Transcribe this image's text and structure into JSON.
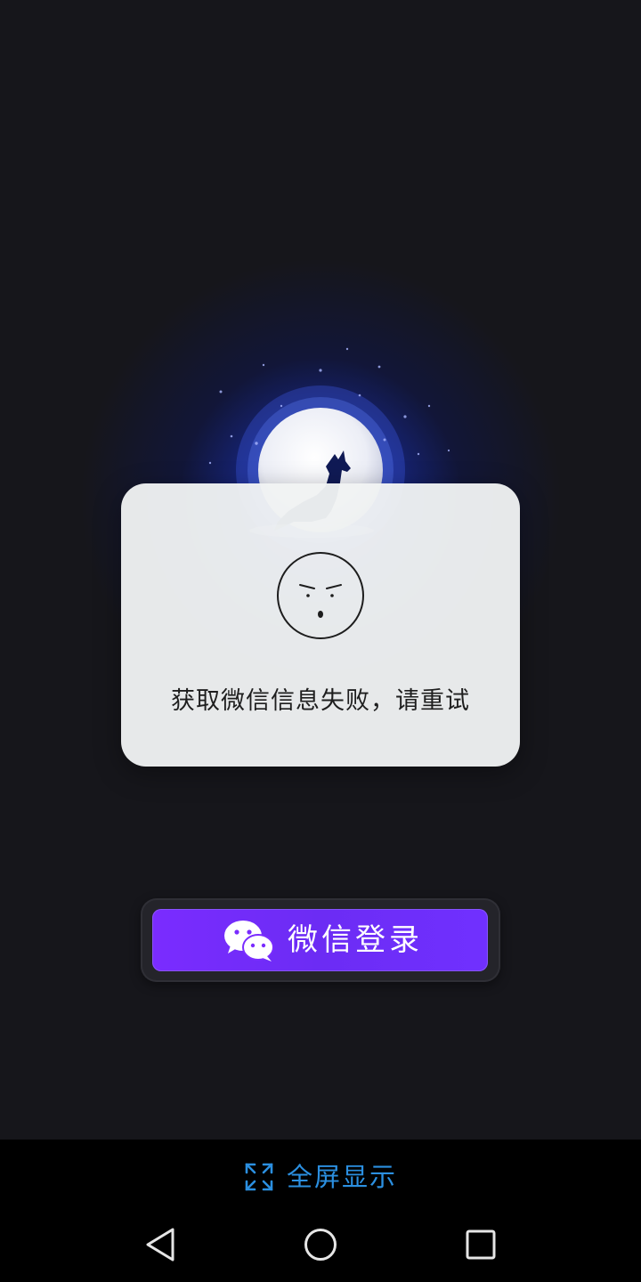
{
  "dialog": {
    "message": "获取微信信息失败，请重试",
    "face_icon": "angry-face-icon"
  },
  "login": {
    "label": "微信登录",
    "icon": "wechat-icon",
    "color": "#7a2cff"
  },
  "bottom_bar": {
    "fullscreen_label": "全屏显示",
    "fullscreen_icon": "expand-icon",
    "accent": "#2b8fe0"
  },
  "nav": {
    "back_icon": "back-triangle-icon",
    "home_icon": "home-circle-icon",
    "recents_icon": "recents-square-icon"
  },
  "background": {
    "art": "moon-wolf-illustration",
    "color": "#16161b"
  }
}
